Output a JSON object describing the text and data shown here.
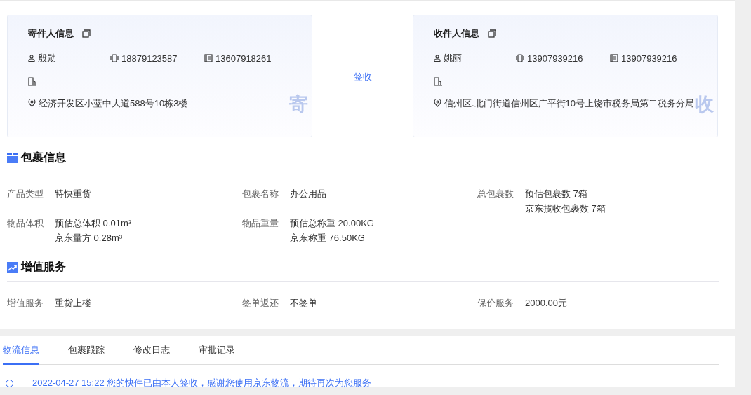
{
  "cards": [
    {
      "title": "寄件人信息",
      "name": "殷勋",
      "mobile": "18879123587",
      "phone": "13607918261",
      "address": "经济开发区小蓝中大道588号10栋3楼",
      "mark": "寄"
    },
    {
      "title": "收件人信息",
      "name": "姚丽",
      "mobile": "13907939216",
      "phone": "13907939216",
      "address": "信州区.北门街道信州区广平街10号上饶市税务局第二税务分局",
      "mark": "收"
    }
  ],
  "transfer_label": "签收",
  "sections": [
    {
      "title": "包裹信息",
      "kind": "package",
      "fields": [
        {
          "label": "产品类型",
          "values": [
            "特快重货"
          ]
        },
        {
          "label": "包裹名称",
          "values": [
            "办公用品"
          ]
        },
        {
          "label": "总包裹数",
          "values": [
            "预估包裹数 7箱",
            "京东揽收包裹数 7箱"
          ]
        },
        {
          "label": "物品体积",
          "values": [
            "预估总体积 0.01m³",
            "京东量方 0.28m³"
          ]
        },
        {
          "label": "物品重量",
          "values": [
            "预估总称重 20.00KG",
            "京东称重 76.50KG"
          ]
        }
      ]
    },
    {
      "title": "增值服务",
      "kind": "service",
      "fields": [
        {
          "label": "增值服务",
          "values": [
            "重货上楼"
          ]
        },
        {
          "label": "签单返还",
          "values": [
            "不签单"
          ]
        },
        {
          "label": "保价服务",
          "values": [
            "2000.00元"
          ]
        }
      ]
    }
  ],
  "tabs": [
    {
      "label": "物流信息",
      "selected": true
    },
    {
      "label": "包裹跟踪",
      "selected": false
    },
    {
      "label": "修改日志",
      "selected": false
    },
    {
      "label": "审批记录",
      "selected": false
    }
  ],
  "timeline": [
    {
      "time": "2022-04-27 15:22",
      "text": "您的快件已由本人签收，感谢您使用京东物流，期待再次为您服务"
    }
  ]
}
